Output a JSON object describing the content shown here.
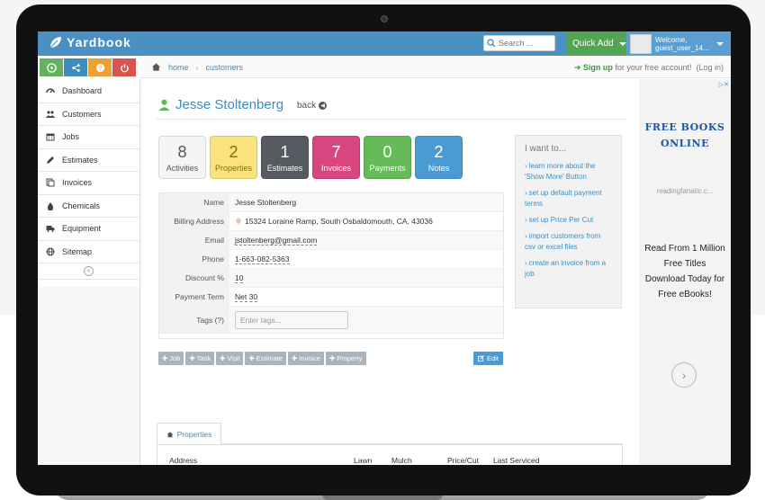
{
  "header": {
    "logo_text": "Yardbook",
    "search_placeholder": "Search ...",
    "quick_add_label": "Quick Add",
    "user_welcome": "Welcome,",
    "user_name": "guest_user_14..."
  },
  "breadcrumb": {
    "home": "home",
    "customers": "customers",
    "signup_bold": "Sign up",
    "signup_rest": "for your free account!",
    "login": "(Log in)"
  },
  "sidebar": {
    "items": [
      {
        "label": "Dashboard"
      },
      {
        "label": "Customers"
      },
      {
        "label": "Jobs"
      },
      {
        "label": "Estimates"
      },
      {
        "label": "Invoices"
      },
      {
        "label": "Chemicals"
      },
      {
        "label": "Equipment"
      },
      {
        "label": "Sitemap"
      }
    ],
    "top_buttons": [
      {
        "icon": "dashboard-icon",
        "color": "#63b35e"
      },
      {
        "icon": "share-icon",
        "color": "#3c8dbc"
      },
      {
        "icon": "help-icon",
        "color": "#f0a030"
      },
      {
        "icon": "power-icon",
        "color": "#d9534f"
      }
    ]
  },
  "customer": {
    "name": "Jesse Stoltenberg",
    "back_label": "back",
    "counts": [
      {
        "num": "8",
        "label": "Activities",
        "bg": "#f5f5f5",
        "fg": "#555"
      },
      {
        "num": "2",
        "label": "Properties",
        "bg": "#fbe27d",
        "fg": "#8a6d00"
      },
      {
        "num": "1",
        "label": "Estimates",
        "bg": "#555b60",
        "fg": "#ffffff"
      },
      {
        "num": "7",
        "label": "Invoices",
        "bg": "#d9467f",
        "fg": "#ffffff"
      },
      {
        "num": "0",
        "label": "Payments",
        "bg": "#67ba5a",
        "fg": "#ffffff"
      },
      {
        "num": "2",
        "label": "Notes",
        "bg": "#4a9bd4",
        "fg": "#ffffff"
      }
    ],
    "fields": {
      "name_label": "Name",
      "name_value": "Jesse Stoltenberg",
      "billing_label": "Billing Address",
      "billing_value": "15324 Loraine Ramp, South Osbaldomouth, CA, 43036",
      "email_label": "Email",
      "email_value": "jstoltenberg@gmail.com",
      "phone_label": "Phone",
      "phone_value": "1-663-082-5363",
      "discount_label": "Discount %",
      "discount_value": "10",
      "term_label": "Payment Term",
      "term_value": "Net 30",
      "tags_label": "Tags (?)",
      "tags_placeholder": "Enter tags..."
    },
    "actions": [
      "Job",
      "Task",
      "Visit",
      "Estimate",
      "Invoice",
      "Property"
    ],
    "edit_label": "Edit"
  },
  "iwant": {
    "title": "I want to...",
    "links": [
      "learn more about the 'Show More' Button",
      "set up default payment terms",
      "set up Price Per Cut",
      "import customers from csv or excel files",
      "create an invoice from a job"
    ]
  },
  "properties": {
    "tab_label": "Properties",
    "columns": {
      "address": "Address",
      "lawn": "Lawn Size",
      "mulch": "Mulch Quantity",
      "price": "Price/Cut ($)",
      "last": "Last Serviced"
    }
  },
  "ad": {
    "title": "FREE BOOKS ONLINE",
    "site": "readingfanatic.c...",
    "body": "Read From 1 Million Free Titles Download Today for Free eBooks!"
  }
}
